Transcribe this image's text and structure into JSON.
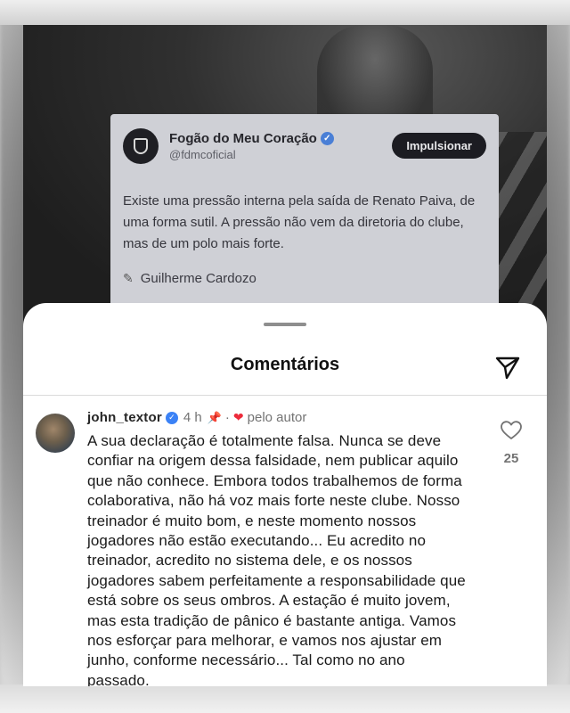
{
  "tweet": {
    "account_name": "Fogão do Meu Coração",
    "handle": "@fdmcoficial",
    "boost_label": "Impulsionar",
    "text": "Existe uma pressão interna pela saída de Renato Paiva, de uma forma sutil. A pressão não vem da diretoria do clube, mas de um polo mais forte.",
    "author_credit": "Guilherme Cardozo",
    "credit_icon": "pen-icon",
    "verified_icon": "verified-badge-icon"
  },
  "sheet": {
    "title": "Comentários",
    "share_icon": "send-icon"
  },
  "comment": {
    "username": "john_textor",
    "time": "4 h",
    "pin_icon": "pin-icon",
    "separator": "·",
    "liked_by_author": "pelo autor",
    "text": "A sua declaração é totalmente falsa. Nunca se deve confiar na origem dessa falsidade, nem publicar aquilo que não conhece. Embora todos trabalhemos de forma colaborativa, não há voz mais forte neste clube. Nosso treinador é muito bom, e neste momento nossos jogadores não estão executando... Eu acredito no treinador, acredito no sistema dele, e os nossos jogadores sabem perfeitamente a responsabilidade que está sobre os seus ombros. A estação é muito jovem, mas esta tradição de pânico é bastante antiga. Vamos nos esforçar para melhorar, e vamos nos ajustar em junho, conforme necessário... Tal como no ano passado.",
    "like_count": "25"
  },
  "colors": {
    "verified": "#3b82f6",
    "heart": "#ed2b3b",
    "sheet_bg": "#ffffff",
    "boost_button": "#1c1c22"
  }
}
